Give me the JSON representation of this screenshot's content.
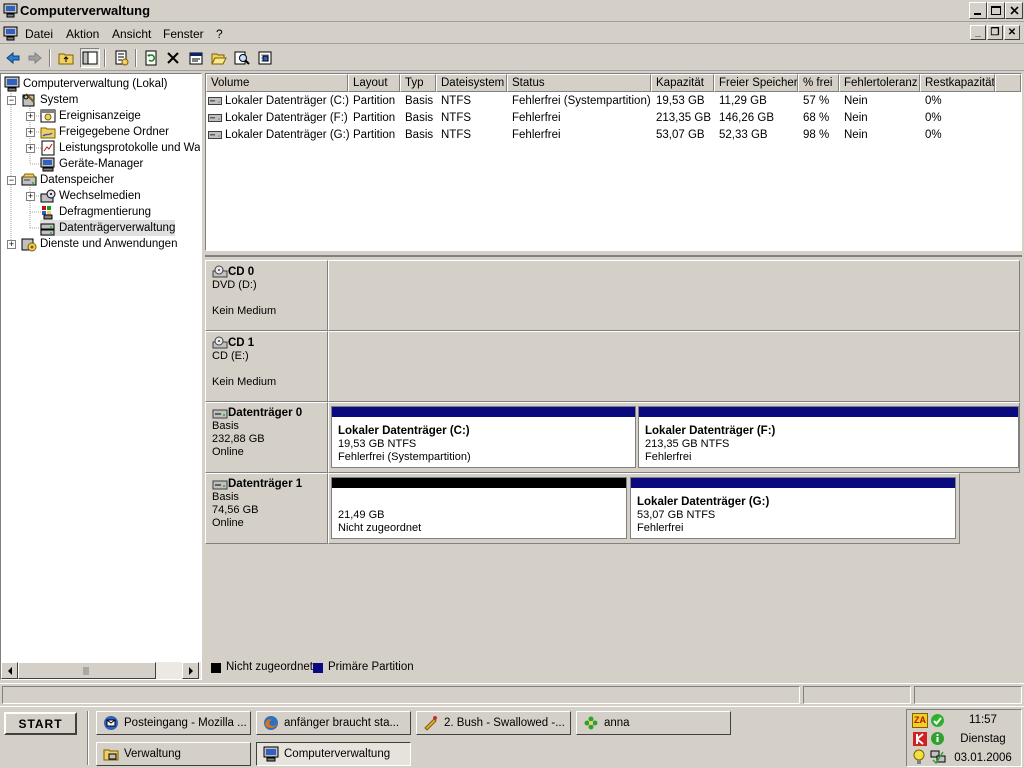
{
  "window": {
    "title": "Computerverwaltung"
  },
  "menubar": {
    "items": [
      "Datei",
      "Aktion",
      "Ansicht",
      "Fenster",
      "?"
    ]
  },
  "tree": {
    "root": "Computerverwaltung (Lokal)",
    "system": "System",
    "ereignis": "Ereignisanzeige",
    "ordner": "Freigegebene Ordner",
    "leistung": "Leistungsprotokolle und Warnungen",
    "geraete": "Geräte-Manager",
    "datenspeicher": "Datenspeicher",
    "wechsel": "Wechselmedien",
    "defrag": "Defragmentierung",
    "dtv": "Datenträgerverwaltung",
    "dienste": "Dienste und Anwendungen"
  },
  "volumes": {
    "columns": [
      "Volume",
      "Layout",
      "Typ",
      "Dateisystem",
      "Status",
      "Kapazität",
      "Freier Speicher",
      "% frei",
      "Fehlertoleranz",
      "Restkapazität"
    ],
    "rows": [
      [
        "Lokaler Datenträger (C:)",
        "Partition",
        "Basis",
        "NTFS",
        "Fehlerfrei (Systempartition)",
        "19,53 GB",
        "11,29 GB",
        "57 %",
        "Nein",
        "0%"
      ],
      [
        "Lokaler Datenträger (F:)",
        "Partition",
        "Basis",
        "NTFS",
        "Fehlerfrei",
        "213,35 GB",
        "146,26 GB",
        "68 %",
        "Nein",
        "0%"
      ],
      [
        "Lokaler Datenträger (G:)",
        "Partition",
        "Basis",
        "NTFS",
        "Fehlerfrei",
        "53,07 GB",
        "52,33 GB",
        "98 %",
        "Nein",
        "0%"
      ]
    ]
  },
  "disks": {
    "cd0": {
      "name": "CD 0",
      "type": "DVD (D:)",
      "status": "Kein Medium"
    },
    "cd1": {
      "name": "CD 1",
      "type": "CD (E:)",
      "status": "Kein Medium"
    },
    "d0": {
      "name": "Datenträger 0",
      "type": "Basis",
      "size": "232,88 GB",
      "status": "Online",
      "p1": {
        "title": "Lokaler Datenträger  (C:)",
        "size": "19,53 GB NTFS",
        "status": "Fehlerfrei (Systempartition)"
      },
      "p2": {
        "title": "Lokaler Datenträger  (F:)",
        "size": "213,35 GB NTFS",
        "status": "Fehlerfrei"
      }
    },
    "d1": {
      "name": "Datenträger 1",
      "type": "Basis",
      "size": "74,56 GB",
      "status": "Online",
      "p1": {
        "size": "21,49 GB",
        "status": "Nicht zugeordnet"
      },
      "p2": {
        "title": "Lokaler Datenträger  (G:)",
        "size": "53,07 GB NTFS",
        "status": "Fehlerfrei"
      }
    }
  },
  "legend": {
    "unallocated": "Nicht zugeordnet",
    "primary": "Primäre Partition"
  },
  "colors": {
    "primary": "#0a0a80",
    "unallocated": "#000000"
  },
  "taskbar": {
    "start": "START",
    "tasks": [
      "Posteingang - Mozilla ...",
      "anfänger braucht sta...",
      "2. Bush - Swallowed -...",
      "anna",
      "Verwaltung",
      "Computerverwaltung"
    ],
    "clock": {
      "time": "11:57",
      "day": "Dienstag",
      "date": "03.01.2006"
    },
    "tray_text": "ZA"
  }
}
